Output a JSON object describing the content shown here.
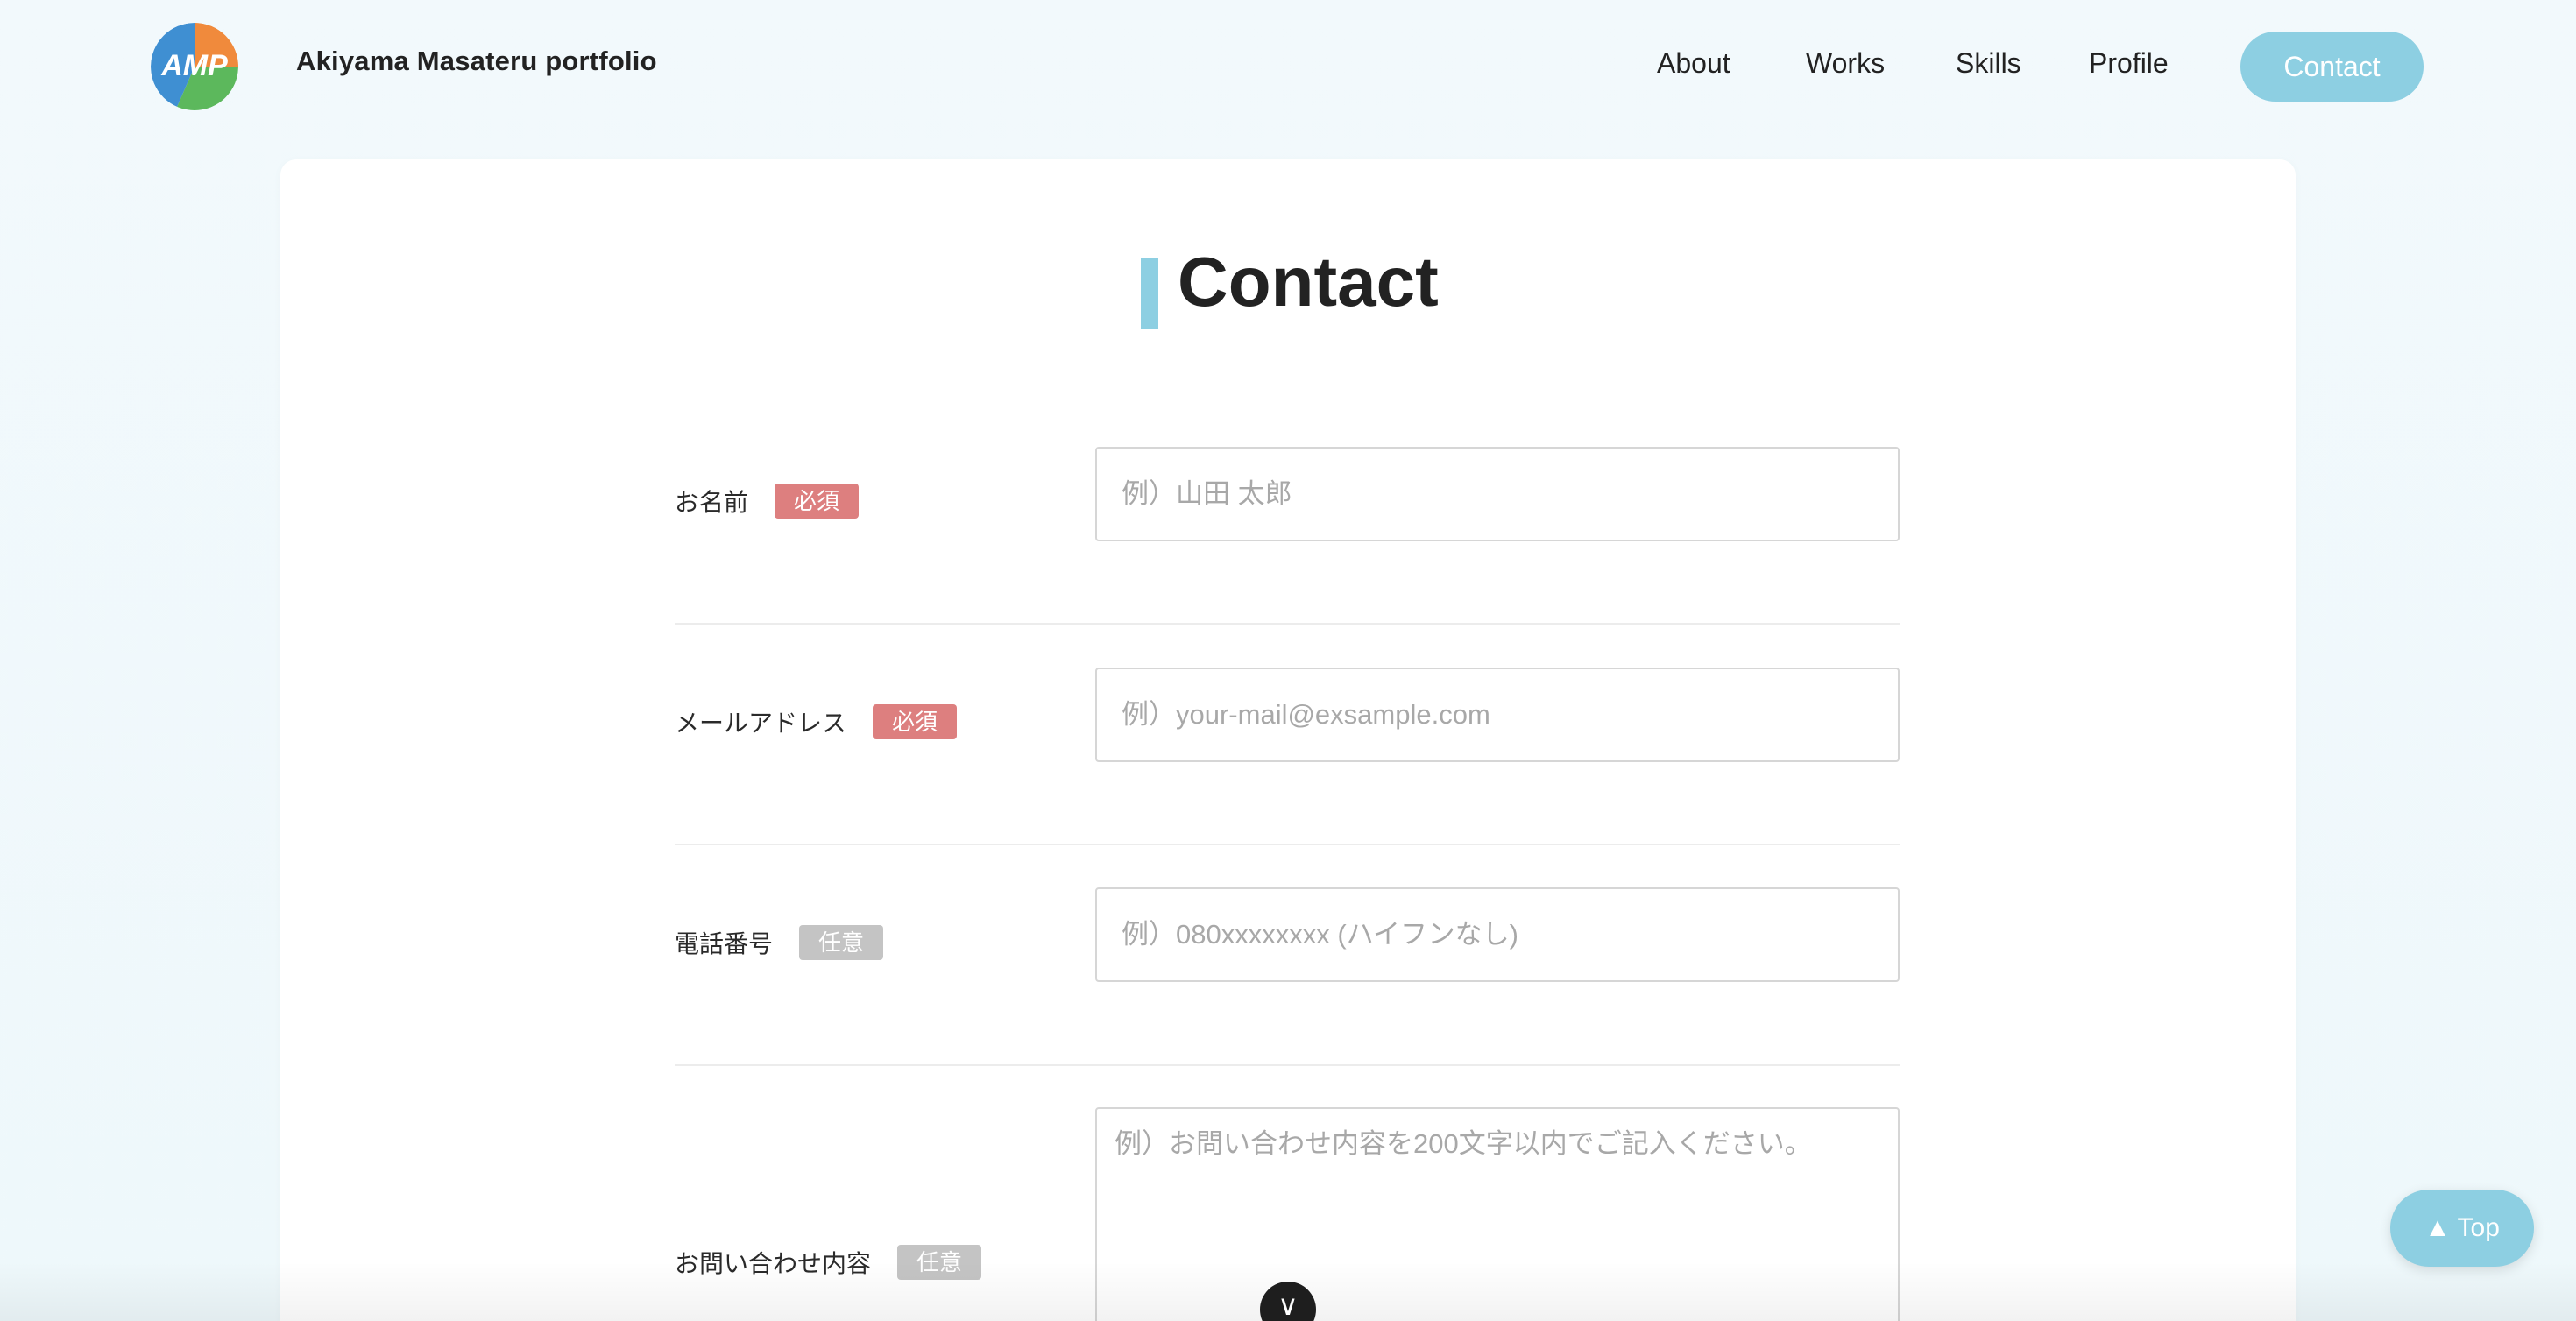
{
  "header": {
    "logo_text": "AMP",
    "site_title": "Akiyama Masateru portfolio",
    "nav": [
      {
        "label": "About"
      },
      {
        "label": "Works"
      },
      {
        "label": "Skills"
      },
      {
        "label": "Profile"
      }
    ],
    "contact_label": "Contact"
  },
  "colors": {
    "accent": "#8dcfe2",
    "required_badge": "#dd7f7f",
    "optional_badge": "#c4c4c4",
    "logo_orange": "#f08a3c",
    "logo_blue": "#3f8fd2",
    "logo_green": "#5cb85c"
  },
  "main": {
    "title": "Contact",
    "fields": [
      {
        "label": "お名前",
        "badge": "必須",
        "placeholder": "例）山田 太郎",
        "value": ""
      },
      {
        "label": "メールアドレス",
        "badge": "必須",
        "placeholder": "例）your-mail@exsample.com",
        "value": ""
      },
      {
        "label": "電話番号",
        "badge": "任意",
        "placeholder": "例）080xxxxxxxx (ハイフンなし)",
        "value": ""
      },
      {
        "label": "お問い合わせ内容",
        "badge": "任意",
        "placeholder": "例）お問い合わせ内容を200文字以内でご記入ください。",
        "value": ""
      }
    ]
  },
  "top_button_label": "▲ Top",
  "scroll_indicator_glyph": "∨",
  "icons": {
    "logo": "amp-logo-icon",
    "scroll": "chevron-down-icon",
    "top": "arrow-up-icon"
  }
}
